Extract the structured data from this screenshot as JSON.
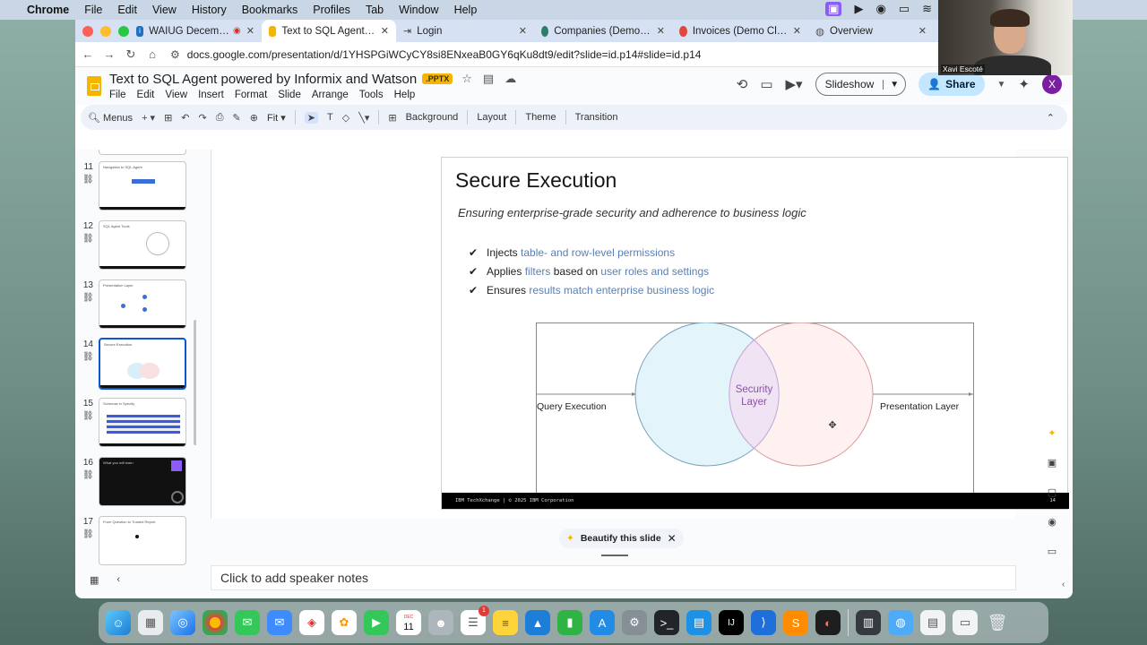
{
  "menubar": {
    "app": "Chrome",
    "items": [
      "File",
      "Edit",
      "View",
      "History",
      "Bookmarks",
      "Profiles",
      "Tab",
      "Window",
      "Help"
    ]
  },
  "tabs": [
    {
      "title": "WAIUG December 2025 T",
      "favicon": "IBM"
    },
    {
      "title": "Text to SQL Agent powered b",
      "favicon": "slides",
      "active": true
    },
    {
      "title": "Login",
      "favicon": "login"
    },
    {
      "title": "Companies (Demo Cloud CRM",
      "favicon": "crm"
    },
    {
      "title": "Invoices (Demo Cloud ERP)",
      "favicon": "erp"
    },
    {
      "title": "Overview",
      "favicon": "globe"
    }
  ],
  "address": {
    "url": "docs.google.com/presentation/d/1YHSPGiWCyCY8si8ENxeaB0GY6qKu8dt9/edit?slide=id.p14#slide=id.p14"
  },
  "doc": {
    "title": "Text to SQL Agent powered by Informix and Watson",
    "badge": ".PPTX",
    "menus": [
      "File",
      "Edit",
      "View",
      "Insert",
      "Format",
      "Slide",
      "Arrange",
      "Tools",
      "Help"
    ],
    "slideshow_label": "Slideshow",
    "share_label": "Share",
    "avatar": "X"
  },
  "toolbar": {
    "menus_label": "Menus",
    "zoom": "Fit",
    "background": "Background",
    "layout": "Layout",
    "theme": "Theme",
    "transition": "Transition"
  },
  "filmstrip": [
    {
      "num": "11",
      "title": "Navigation to SQL Agent"
    },
    {
      "num": "12",
      "title": "SQL Agent Tools"
    },
    {
      "num": "13",
      "title": "Presentation Layer"
    },
    {
      "num": "14",
      "title": "Secure Execution",
      "selected": true
    },
    {
      "num": "15",
      "title": "Schemas in Specify"
    },
    {
      "num": "16",
      "title": "What you will learn"
    },
    {
      "num": "17",
      "title": "From Question to Trusted Report"
    }
  ],
  "slide": {
    "title": "Secure Execution",
    "subtitle": "Ensuring enterprise-grade security and adherence to business logic",
    "bullets": [
      {
        "pre": "Injects ",
        "hl1": "table- and row-level permissions",
        "mid": "",
        "hl2": ""
      },
      {
        "pre": "Applies ",
        "hl1": "filters",
        "mid": " based on ",
        "hl2": "user roles and settings"
      },
      {
        "pre": "Ensures ",
        "hl1": "results match enterprise business logic",
        "mid": "",
        "hl2": ""
      }
    ],
    "diagram": {
      "left_label": "Query Execution",
      "center_label_1": "Security",
      "center_label_2": "Layer",
      "right_label": "Presentation Layer"
    },
    "footer": "IBM TechXchange | © 2025 IBM Corporation",
    "page": "14"
  },
  "beautify": {
    "label": "Beautify this slide"
  },
  "notes": {
    "placeholder": "Click to add speaker notes"
  },
  "webcam": {
    "name": "Xavi Escoté"
  },
  "dock": {
    "calendar_day": "11",
    "calendar_month": "DEC",
    "mail_badge": "1"
  }
}
